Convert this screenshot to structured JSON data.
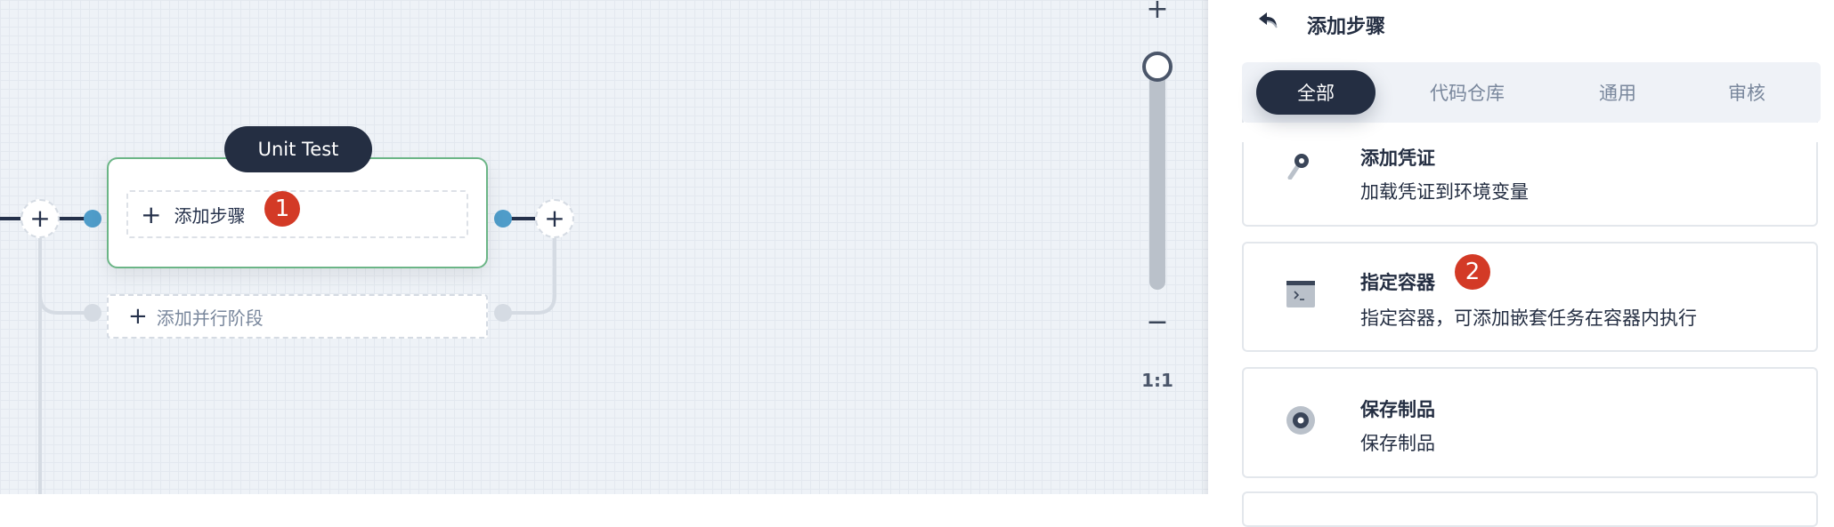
{
  "pipeline": {
    "stage_title": "Unit Test",
    "add_step_label": "添加步骤",
    "add_parallel_label": "添加并行阶段",
    "plus_symbol": "+",
    "badge_1": "1"
  },
  "zoom_control": {
    "plus": "+",
    "minus": "−",
    "ratio": "1:1",
    "level": 1.0
  },
  "panel": {
    "title": "添加步骤",
    "tabs": [
      {
        "label": "全部",
        "active": true
      },
      {
        "label": "代码仓库",
        "active": false
      },
      {
        "label": "通用",
        "active": false
      },
      {
        "label": "审核",
        "active": false
      }
    ],
    "cards": [
      {
        "title": "添加凭证",
        "description": "加载凭证到环境变量",
        "icon": "key-icon"
      },
      {
        "title": "指定容器",
        "description": "指定容器，可添加嵌套任务在容器内执行",
        "icon": "terminal-icon",
        "badge": "2"
      },
      {
        "title": "保存制品",
        "description": "保存制品",
        "icon": "artifact-icon"
      }
    ]
  },
  "colors": {
    "accent_dark": "#242e42",
    "stage_border": "#6bb586",
    "connector": "#4f9cc9",
    "badge": "#d33a26"
  }
}
